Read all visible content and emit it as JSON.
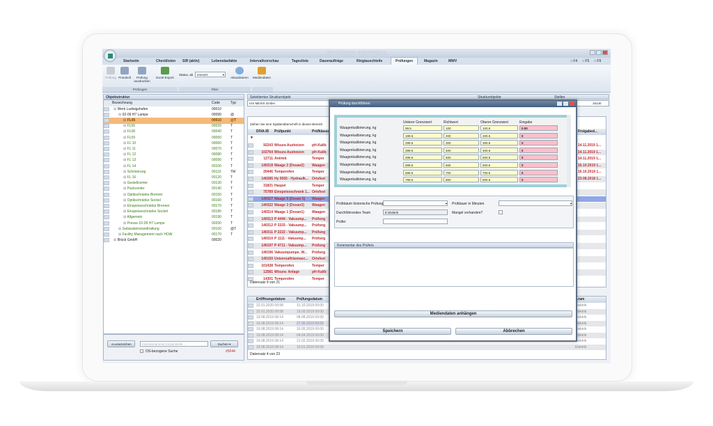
{
  "app": {
    "title": "Diva Dynamics - Instandhaltung",
    "fkeys": [
      "F4",
      "F5",
      "F9"
    ]
  },
  "tabs": [
    "Startseite",
    "Checklisten",
    "SIR (aktiv)",
    "Lebenslaufakte",
    "Intervallvorschau",
    "Tagesliste",
    "Daueraufträge",
    "Ringtauschteile",
    "Prüfungen",
    "Magazin",
    "MWV"
  ],
  "active_tab": "Prüfungen",
  "ribbon": {
    "pruefung": "Prüfung",
    "protokoll": "Protokoll",
    "pruefung_drucken": "Prüfung ausdrucken",
    "excel": "Excel-Export",
    "group_pruefungen": "Prüfungen",
    "status_label": "Status, ab",
    "status_value": "erinnert",
    "aktualisieren": "Aktualisieren",
    "group_filter": "Filter",
    "mediendaten": "Mediendaten"
  },
  "tree": {
    "title": "Objektstruktur",
    "col_name": "Bezeichnung",
    "col_code": "Code",
    "col_typ": "Typ",
    "items": [
      {
        "name": "Werk Ludwigshafen",
        "code": "00010",
        "typ": "",
        "level": 0,
        "color": "dark"
      },
      {
        "name": "02-09 H7 Lampe",
        "code": "00090",
        "typ": "@",
        "level": 1,
        "color": "dark"
      },
      {
        "name": "FL05",
        "code": "00010",
        "typ": "@T",
        "level": 2,
        "color": "sel"
      },
      {
        "name": "FL06",
        "code": "00020",
        "typ": "T",
        "level": 2,
        "color": "green"
      },
      {
        "name": "FL08",
        "code": "00040",
        "typ": "T",
        "level": 2,
        "color": "green"
      },
      {
        "name": "FL09",
        "code": "00050",
        "typ": "T",
        "level": 2,
        "color": "green"
      },
      {
        "name": "FL 10",
        "code": "00060",
        "typ": "T",
        "level": 2,
        "color": "green"
      },
      {
        "name": "FL 11",
        "code": "00070",
        "typ": "T",
        "level": 2,
        "color": "green"
      },
      {
        "name": "FL 12",
        "code": "00080",
        "typ": "T",
        "level": 2,
        "color": "green"
      },
      {
        "name": "FL 13",
        "code": "00090",
        "typ": "T",
        "level": 2,
        "color": "green"
      },
      {
        "name": "FL 14",
        "code": "00100",
        "typ": "T",
        "level": 2,
        "color": "green"
      },
      {
        "name": "Schmierung",
        "code": "00110",
        "typ": "TM",
        "level": 2,
        "color": "green"
      },
      {
        "name": "FL 16",
        "code": "00120",
        "typ": "T",
        "level": 2,
        "color": "green"
      },
      {
        "name": "Gestellcenter",
        "code": "00130",
        "typ": "T",
        "level": 2,
        "color": "green"
      },
      {
        "name": "Packcenter",
        "code": "00140",
        "typ": "T",
        "level": 2,
        "color": "green"
      },
      {
        "name": "Optikschränke Brenner",
        "code": "00150",
        "typ": "T",
        "level": 2,
        "color": "green"
      },
      {
        "name": "Optikschränke Sockel",
        "code": "00160",
        "typ": "T",
        "level": 2,
        "color": "green"
      },
      {
        "name": "Einspeiseschränke Brenner",
        "code": "00170",
        "typ": "T",
        "level": 2,
        "color": "green"
      },
      {
        "name": "Einspeiseschränke Sockel",
        "code": "00180",
        "typ": "T",
        "level": 2,
        "color": "green"
      },
      {
        "name": "Allgemein",
        "code": "00190",
        "typ": "T",
        "level": 2,
        "color": "green"
      },
      {
        "name": "Presse 02-09 H7 Lampe",
        "code": "00200",
        "typ": "T",
        "level": 2,
        "color": "green"
      },
      {
        "name": "Gebäudeinstandhaltung",
        "code": "00160",
        "typ": "@T",
        "level": 1,
        "color": "green"
      },
      {
        "name": "Facility Management nach HOAI",
        "code": "00170",
        "typ": "T",
        "level": 1,
        "color": "green"
      },
      {
        "name": "Brück GmbH",
        "code": "00020",
        "typ": "",
        "level": 0,
        "color": "dark"
      }
    ],
    "bookmarks": "Lesezeichen",
    "search_placeholder": "Inventarnummer,Kostenstelle...",
    "search_btn": "Suchen",
    "os_search": "OS-bezogene Suche",
    "count": "#5044"
  },
  "middle": {
    "title": "Selektiertes Strukturobjekt",
    "object": "IAS MEXIS GmbH",
    "struct_label": "Strukturobjekte",
    "stellen_label": "Stellen",
    "right_value": "16140",
    "group_hint": "Ziehen Sie eine Spaltenüberschrift in diesen Bereich",
    "cols": [
      "DIVA-ID",
      "Prüfpunkt",
      "Prüfklasse"
    ],
    "freigabe_col": "Freigabed...",
    "rows": [
      [
        "92243",
        "Wisura Ausheizen",
        "pH-Kalib"
      ],
      [
        "102764",
        "Wisura Ausheizen",
        "pH-Kalib"
      ],
      [
        "12711",
        "Antrieb",
        "Temper"
      ],
      [
        "140318",
        "Waage 2 (Dosan2)",
        "Waagen"
      ],
      [
        "20446",
        "Temperofen",
        "Temper"
      ],
      [
        "140285",
        "Hy 5555 - Hydraulk...",
        "Ortsfest"
      ],
      [
        "31831",
        "Haspel",
        "Temper"
      ],
      [
        "75789",
        "Einspeiseschrank 1...",
        "Ortsfest"
      ],
      [
        "140327",
        "Waage 5 (Dosan 5)",
        "Waagen"
      ],
      [
        "140322",
        "Waage 3 (Dosan3)",
        "Waagen"
      ],
      [
        "140314",
        "Waage 1 (Dosan1)",
        "Waagen"
      ],
      [
        "140313",
        "P 4444 - Vakuump...",
        "Prüfung"
      ],
      [
        "140312",
        "P 3333 - Vakuump...",
        "Prüfung"
      ],
      [
        "140311",
        "P 2222 - Vakuump...",
        "Prüfung"
      ],
      [
        "140310",
        "P 1111 - Vakuump...",
        "Prüfung"
      ],
      [
        "140197",
        "P 4711 - Vakuump...",
        "Prüfung"
      ],
      [
        "140196",
        "Vakuumpumpe, W...",
        "Prüfung"
      ],
      [
        "140150",
        "Universalfräsmasc...",
        "Ortsfest"
      ],
      [
        "101438",
        "Temperofen",
        "Temper"
      ],
      [
        "12581",
        "Wisura- Anlage",
        "pH-Kalib"
      ],
      [
        "14301",
        "Temperofen",
        "Temper"
      ]
    ],
    "freigabe": [
      "14.11.2019 1...",
      "14.11.2019 1...",
      "14.11.2019 1...",
      "16.10.2019 1...",
      "16.10.2019 1...",
      "23.08.2018 1..."
    ],
    "footer": "Datensatz 9 von 21",
    "hist_cols": [
      "Eröffnungsdatum",
      "Prüfungsdatum",
      "...ram"
    ],
    "hist_rows": [
      [
        "22.01.2020 09:58",
        "31.10.2019 00:00"
      ],
      [
        "22.01.2020 09:58",
        "19.09.2019 00:00"
      ],
      [
        "19.08.2019 08:14",
        "08.08.2019 00:00"
      ],
      [
        "19.08.2019 08:14",
        "27.06.2019 00:00"
      ],
      [
        "19.08.2019 08:14",
        "16.05.2019 00:00"
      ],
      [
        "19.08.2019 08:14",
        "04.04.2019 00:00"
      ],
      [
        "19.08.2019 08:14",
        "21.02.2019 00:00"
      ],
      [
        "19.08.2019 08:14",
        "10.01.2019 00:00"
      ]
    ],
    "hist_team": "Elektrik",
    "hist_footer": "Datensatz 4 von 23"
  },
  "dialog": {
    "title": "Prüfung durchführen",
    "cols": [
      "Unterer Grenzwert",
      "Richtwert",
      "Oberer Grenzwert",
      "Eingabe"
    ],
    "rows": [
      {
        "label": "Waagenkalibrierung, kg",
        "lo": "99.5",
        "mid": "100",
        "hi": "100.5",
        "in": "0.00"
      },
      {
        "label": "Waagenkalibrierung, kg",
        "lo": "199.5",
        "mid": "200",
        "hi": "200.5",
        "in": "0"
      },
      {
        "label": "Waagenkalibrierung, kg",
        "lo": "299.5",
        "mid": "300",
        "hi": "300.5",
        "in": "0"
      },
      {
        "label": "Waagenkalibrierung, kg",
        "lo": "399.5",
        "mid": "400",
        "hi": "400.5",
        "in": "0"
      },
      {
        "label": "Waagenkalibrierung, kg",
        "lo": "499.5",
        "mid": "500",
        "hi": "500.5",
        "in": "0"
      },
      {
        "label": "Waagenkalibrierung, kg",
        "lo": "599.5",
        "mid": "600",
        "hi": "600.5",
        "in": "0"
      },
      {
        "label": "Waagenkalibrierung, kg",
        "lo": "699.5",
        "mid": "700",
        "hi": "700.5",
        "in": "0"
      },
      {
        "label": "Waagenkalibrierung, kg",
        "lo": "799.5",
        "mid": "800",
        "hi": "800.5",
        "in": "0"
      }
    ],
    "hist_date": "Prüfdatum historische Prüfung",
    "duration": "Prüfdauer in Minuten",
    "team": "Durchführendes Team",
    "team_value": "E Elektrik",
    "defects": "Mangel vorhanden?",
    "inspector": "Prüfer",
    "comment": "Kommentar des Prüfers",
    "attach": "Mediendaten anhängen",
    "save": "Speichern",
    "cancel": "Abbrechen"
  }
}
